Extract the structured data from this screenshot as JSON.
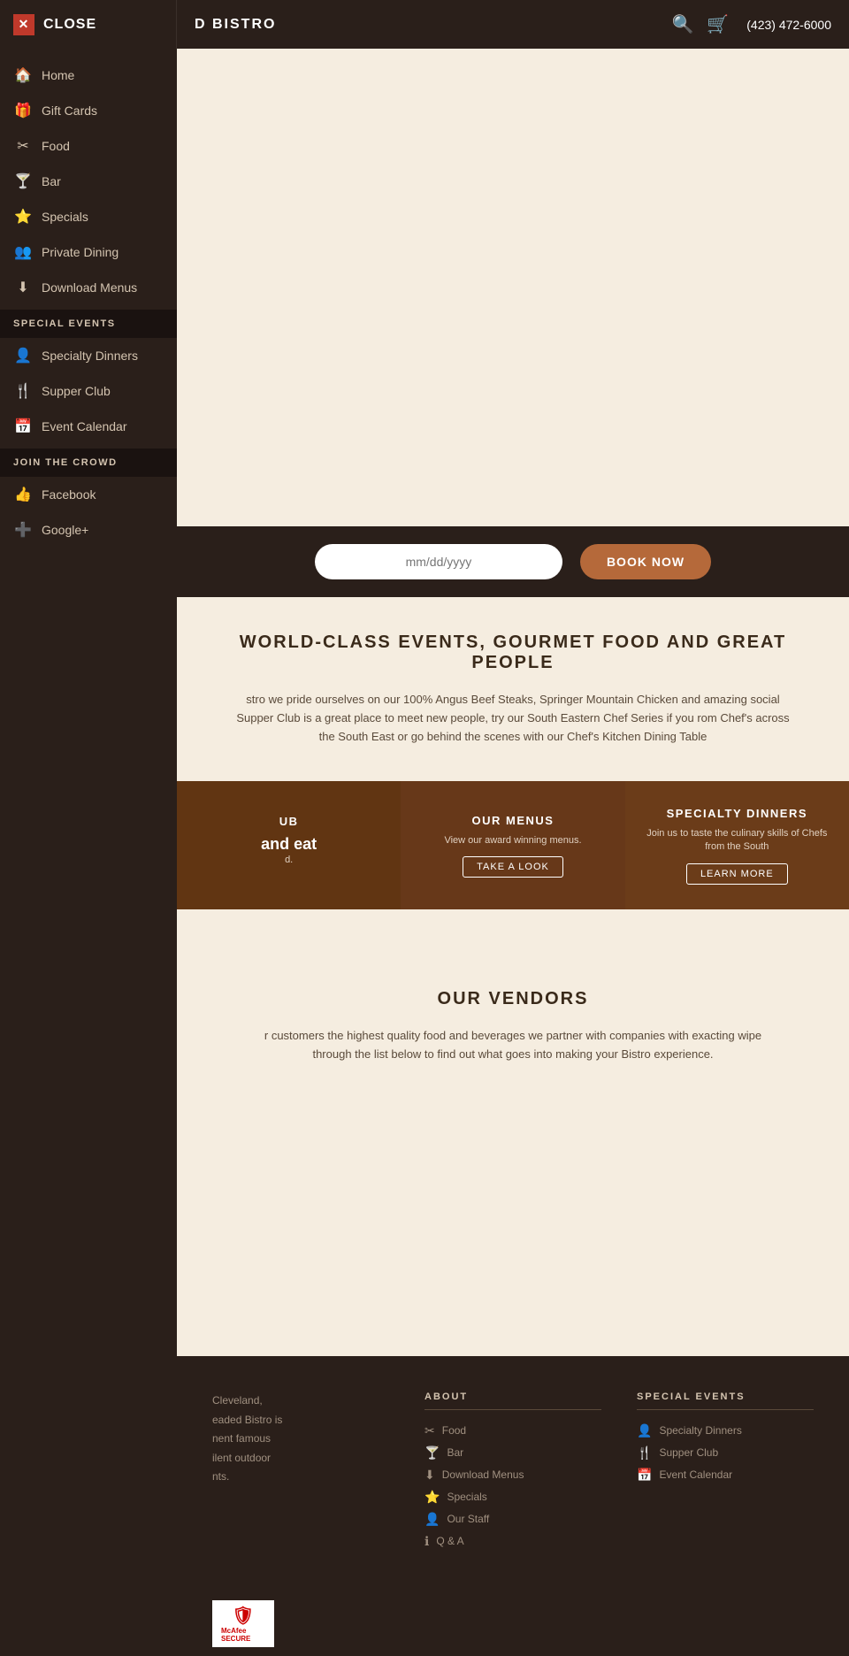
{
  "header": {
    "close_label": "CLOSE",
    "brand_name": "D BISTRO",
    "phone": "(423) 472-6000",
    "icons": {
      "search": "🔍",
      "cart": "🛒"
    }
  },
  "sidebar": {
    "items": [
      {
        "id": "home",
        "label": "Home",
        "icon": "🏠"
      },
      {
        "id": "gift-cards",
        "label": "Gift Cards",
        "icon": "🎁"
      },
      {
        "id": "food",
        "label": "Food",
        "icon": "✂"
      },
      {
        "id": "bar",
        "label": "Bar",
        "icon": "🍸"
      },
      {
        "id": "specials",
        "label": "Specials",
        "icon": "⭐"
      },
      {
        "id": "private-dining",
        "label": "Private Dining",
        "icon": "👥"
      },
      {
        "id": "download-menus",
        "label": "Download Menus",
        "icon": "⬇"
      }
    ],
    "special_events_label": "SPECIAL EVENTS",
    "special_events_items": [
      {
        "id": "specialty-dinners",
        "label": "Specialty Dinners",
        "icon": "👤"
      },
      {
        "id": "supper-club",
        "label": "Supper Club",
        "icon": "🍴"
      },
      {
        "id": "event-calendar",
        "label": "Event Calendar",
        "icon": "📅"
      }
    ],
    "join_label": "JOIN THE CROWD",
    "social_items": [
      {
        "id": "facebook",
        "label": "Facebook",
        "icon": "👍"
      },
      {
        "id": "google-plus",
        "label": "Google+",
        "icon": "➕"
      }
    ]
  },
  "date_picker": {
    "placeholder": "mm/dd/yyyy",
    "book_now": "BOOK NOW"
  },
  "main": {
    "world_class_heading": "WORLD-CLASS EVENTS, GOURMET FOOD AND GREAT PEOPLE",
    "world_class_text": "stro we pride ourselves on our 100% Angus Beef Steaks, Springer Mountain Chicken and amazing social Supper Club is a great place to meet new people, try our South Eastern Chef Series if you rom Chef's across the South East or go behind the scenes with our Chef's Kitchen Dining Table",
    "cards": [
      {
        "id": "supper-club-card",
        "title": "UB",
        "side_text": "and eat",
        "body_text": "d.",
        "button_label": ""
      },
      {
        "id": "our-menus-card",
        "title": "OUR MENUS",
        "body_text": "View our award winning menus.",
        "button_label": "TAKE A LOOK"
      },
      {
        "id": "specialty-dinners-card",
        "title": "SPECIALTY DINNERS",
        "body_text": "Join us to taste the culinary skills of Chefs from the South",
        "button_label": "LEARN MORE"
      }
    ],
    "vendors_heading": "OUR VENDORS",
    "vendors_text": "r customers the highest quality food and beverages we partner with companies with exacting wipe through the list below to find out what goes into making your Bistro experience."
  },
  "footer": {
    "about_label": "ABOUT",
    "about_links": [
      {
        "label": "Food",
        "icon": "✂"
      },
      {
        "label": "Bar",
        "icon": "🍸"
      },
      {
        "label": "Download Menus",
        "icon": "⬇"
      },
      {
        "label": "Specials",
        "icon": "⭐"
      },
      {
        "label": "Our Staff",
        "icon": "👤"
      },
      {
        "label": "Q & A",
        "icon": "ℹ"
      }
    ],
    "special_events_label": "SPECIAL EVENTS",
    "special_events_links": [
      {
        "label": "Specialty Dinners",
        "icon": "👤"
      },
      {
        "label": "Supper Club",
        "icon": "🍴"
      },
      {
        "label": "Event Calendar",
        "icon": "📅"
      }
    ],
    "address_text": "Cleveland,\neaded Bistro is\nnent famous\nilent outdoor\nnts.",
    "mcafee_label": "McAfee\nSECURE"
  }
}
